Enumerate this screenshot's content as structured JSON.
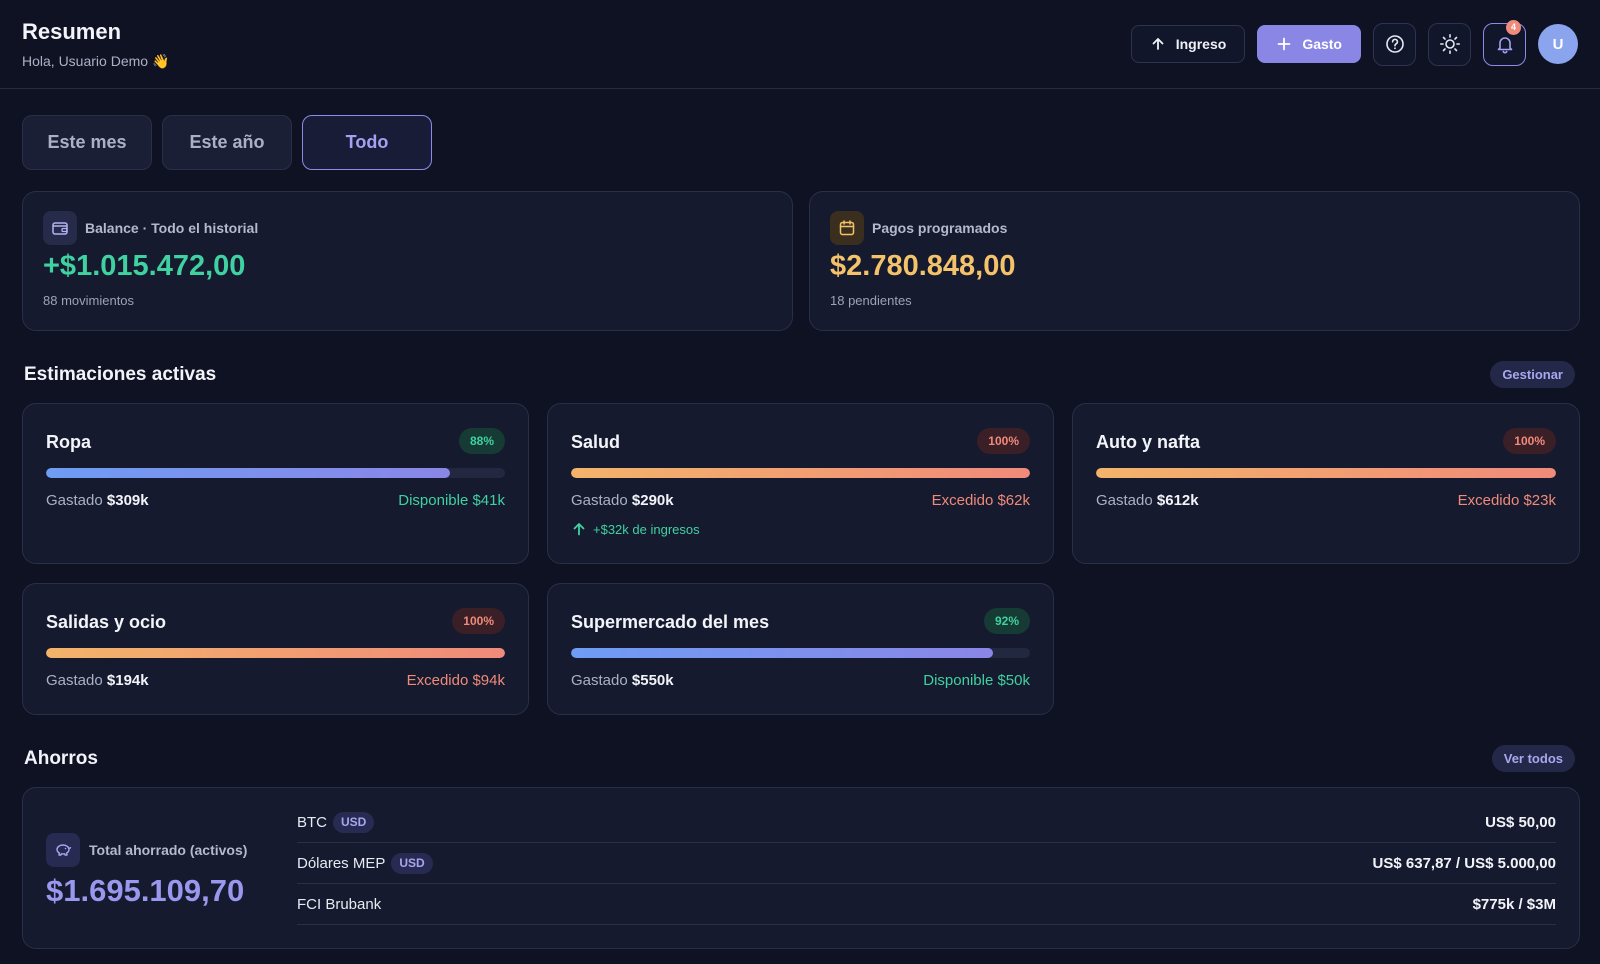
{
  "header": {
    "title": "Resumen",
    "greeting": "Hola, Usuario Demo 👋",
    "income_button": "Ingreso",
    "expense_button": "Gasto",
    "notification_count": "4",
    "avatar_initial": "U"
  },
  "tabs": [
    {
      "label": "Este mes",
      "selected": false
    },
    {
      "label": "Este año",
      "selected": false
    },
    {
      "label": "Todo",
      "selected": true
    }
  ],
  "balance": {
    "label": "Balance · Todo el historial",
    "value": "+$1.015.472,00",
    "sub": "88 movimientos",
    "color": "#3fd2a0"
  },
  "scheduled": {
    "label": "Pagos programados",
    "value": "$2.780.848,00",
    "sub": "18 pendientes",
    "color": "#f3c26a"
  },
  "estimations": {
    "title": "Estimaciones activas",
    "manage_label": "Gestionar",
    "spent_prefix": "Gastado",
    "items": [
      {
        "name": "Ropa",
        "percent": "88%",
        "progress": 0.88,
        "status": "ok",
        "spent": "$309k",
        "remaining": "Disponible $41k"
      },
      {
        "name": "Salud",
        "percent": "100%",
        "progress": 1.0,
        "status": "over",
        "spent": "$290k",
        "remaining": "Excedido $62k",
        "income_note": "+$32k de ingresos"
      },
      {
        "name": "Auto y nafta",
        "percent": "100%",
        "progress": 1.0,
        "status": "over",
        "spent": "$612k",
        "remaining": "Excedido $23k"
      },
      {
        "name": "Salidas y ocio",
        "percent": "100%",
        "progress": 1.0,
        "status": "over",
        "spent": "$194k",
        "remaining": "Excedido $94k"
      },
      {
        "name": "Supermercado del mes",
        "percent": "92%",
        "progress": 0.92,
        "status": "ok",
        "spent": "$550k",
        "remaining": "Disponible $50k"
      }
    ]
  },
  "savings": {
    "title": "Ahorros",
    "view_all_label": "Ver todos",
    "total_label": "Total ahorrado (activos)",
    "total_value": "$1.695.109,70",
    "items": [
      {
        "name": "BTC",
        "currency": "USD",
        "amount": "US$ 50,00"
      },
      {
        "name": "Dólares MEP",
        "currency": "USD",
        "amount": "US$ 637,87 / US$ 5.000,00"
      },
      {
        "name": "FCI Brubank",
        "currency": "",
        "amount": "$775k / $3M"
      }
    ]
  }
}
